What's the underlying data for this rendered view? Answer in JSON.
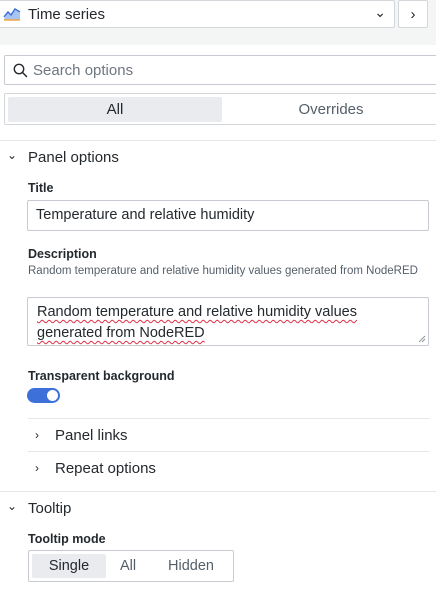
{
  "header": {
    "visualization_label": "Time series",
    "viz_icon": "time-series-chart-icon",
    "dropdown_icon": "chevron-down-icon",
    "collapse_icon": "chevron-right-icon"
  },
  "search": {
    "placeholder": "Search options"
  },
  "tabs": [
    {
      "label": "All",
      "selected": true
    },
    {
      "label": "Overrides",
      "selected": false
    }
  ],
  "panel_options": {
    "title": "Panel options",
    "title_field": {
      "label": "Title",
      "value": "Temperature and relative humidity"
    },
    "description_field": {
      "label": "Description",
      "help": "Random temperature and relative humidity values generated from NodeRED",
      "value": "Random temperature and relative humidity values generated from NodeRED"
    },
    "transparent_background": {
      "label": "Transparent background",
      "enabled": true
    },
    "panel_links": {
      "label": "Panel links"
    },
    "repeat_options": {
      "label": "Repeat options"
    }
  },
  "tooltip": {
    "title": "Tooltip",
    "mode": {
      "label": "Tooltip mode",
      "options": [
        "Single",
        "All",
        "Hidden"
      ],
      "selected": "Single"
    }
  },
  "colors": {
    "accent": "#3d71d9",
    "spellcheck": "#e02f44"
  }
}
